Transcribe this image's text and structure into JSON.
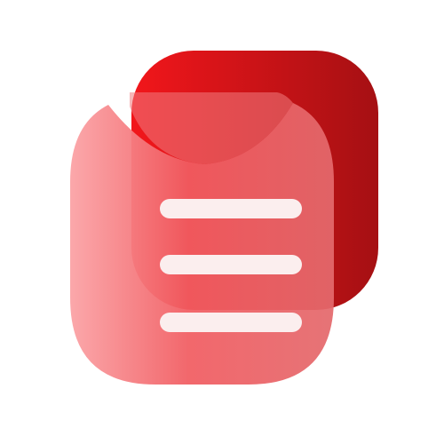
{
  "icon": {
    "name": "document-list-icon",
    "colors": {
      "back_card_light": "#f0161b",
      "back_card_dark": "#a81114",
      "front_card_light": "#fba7aa",
      "front_card_mid": "#ef5a5f",
      "front_card_dark": "#e56a6c",
      "lines": "#fbeeee"
    }
  }
}
